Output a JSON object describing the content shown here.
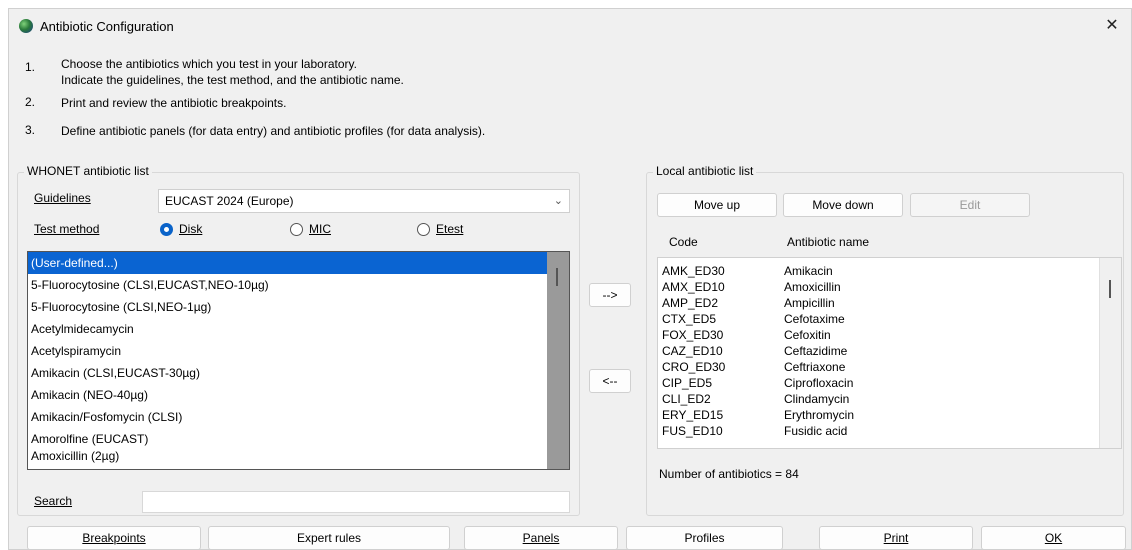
{
  "window": {
    "title": "Antibiotic Configuration",
    "close_glyph": "✕"
  },
  "steps": [
    {
      "num": "1.",
      "lines": [
        "Choose the antibiotics which you test in your laboratory.",
        "Indicate the guidelines, the test method, and the antibiotic name."
      ]
    },
    {
      "num": "2.",
      "lines": [
        "Print and review the antibiotic breakpoints."
      ]
    },
    {
      "num": "3.",
      "lines": [
        "Define antibiotic panels (for data entry) and antibiotic profiles (for data analysis)."
      ]
    }
  ],
  "whonet": {
    "legend": "WHONET antibiotic list",
    "guidelines_label": "Guidelines",
    "guidelines_value": "EUCAST 2024 (Europe)",
    "test_method_label": "Test method",
    "methods": [
      {
        "label": "Disk",
        "selected": true
      },
      {
        "label": "MIC",
        "selected": false
      },
      {
        "label": "Etest",
        "selected": false
      }
    ],
    "items": [
      "(User-defined...)",
      "5-Fluorocytosine (CLSI,EUCAST,NEO-10µg)",
      "5-Fluorocytosine (CLSI,NEO-1µg)",
      "Acetylmidecamycin",
      "Acetylspiramycin",
      "Amikacin (CLSI,EUCAST-30µg)",
      "Amikacin (NEO-40µg)",
      "Amikacin/Fosfomycin (CLSI)",
      "Amorolfine (EUCAST)",
      "Amoxicillin (2µg)"
    ],
    "search_label": "Search",
    "search_value": ""
  },
  "transfer": {
    "add_label": "-->",
    "remove_label": "<--"
  },
  "local": {
    "legend": "Local antibiotic list",
    "move_up": "Move up",
    "move_down": "Move down",
    "edit": "Edit",
    "col_code": "Code",
    "col_name": "Antibiotic name",
    "rows": [
      {
        "code": "AMK_ED30",
        "name": "Amikacin"
      },
      {
        "code": "AMX_ED10",
        "name": "Amoxicillin"
      },
      {
        "code": "AMP_ED2",
        "name": "Ampicillin"
      },
      {
        "code": "CTX_ED5",
        "name": "Cefotaxime"
      },
      {
        "code": "FOX_ED30",
        "name": "Cefoxitin"
      },
      {
        "code": "CAZ_ED10",
        "name": "Ceftazidime"
      },
      {
        "code": "CRO_ED30",
        "name": "Ceftriaxone"
      },
      {
        "code": "CIP_ED5",
        "name": "Ciprofloxacin"
      },
      {
        "code": "CLI_ED2",
        "name": "Clindamycin"
      },
      {
        "code": "ERY_ED15",
        "name": "Erythromycin"
      },
      {
        "code": "FUS_ED10",
        "name": "Fusidic acid"
      }
    ],
    "count_text": "Number of antibiotics = 84"
  },
  "footer": {
    "breakpoints": "Breakpoints",
    "expert_rules": "Expert rules",
    "panels": "Panels",
    "profiles": "Profiles",
    "print": "Print",
    "ok": "OK"
  }
}
